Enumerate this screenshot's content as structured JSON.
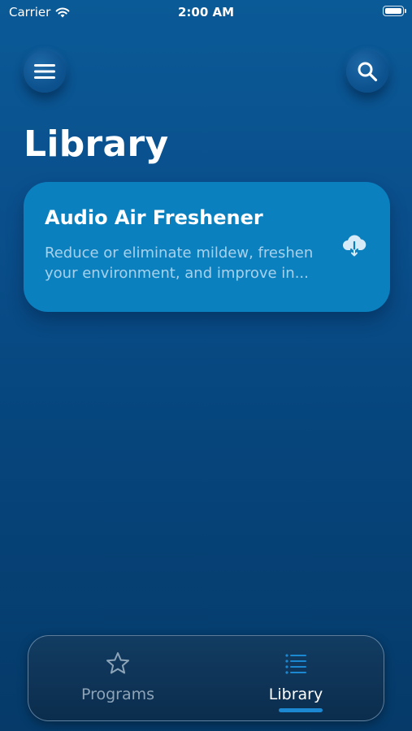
{
  "status_bar": {
    "carrier": "Carrier",
    "time": "2:00 AM"
  },
  "header": {
    "menu_icon": "hamburger-menu-icon",
    "search_icon": "search-icon",
    "title": "Library"
  },
  "library_items": [
    {
      "title": "Audio Air Freshener",
      "description": "Reduce or eliminate mildew, freshen your environment, and improve in...",
      "icon": "cloud-download-icon"
    }
  ],
  "tab_bar": {
    "tabs": [
      {
        "label": "Programs",
        "icon": "star-icon",
        "selected": false
      },
      {
        "label": "Library",
        "icon": "list-icon",
        "selected": true
      }
    ]
  },
  "colors": {
    "background_top": "#0a5a97",
    "background_bottom": "#053a69",
    "card": "#0b80bf",
    "tab_active_accent": "#1b88d1",
    "tab_inactive_text": "#8da4b8"
  }
}
